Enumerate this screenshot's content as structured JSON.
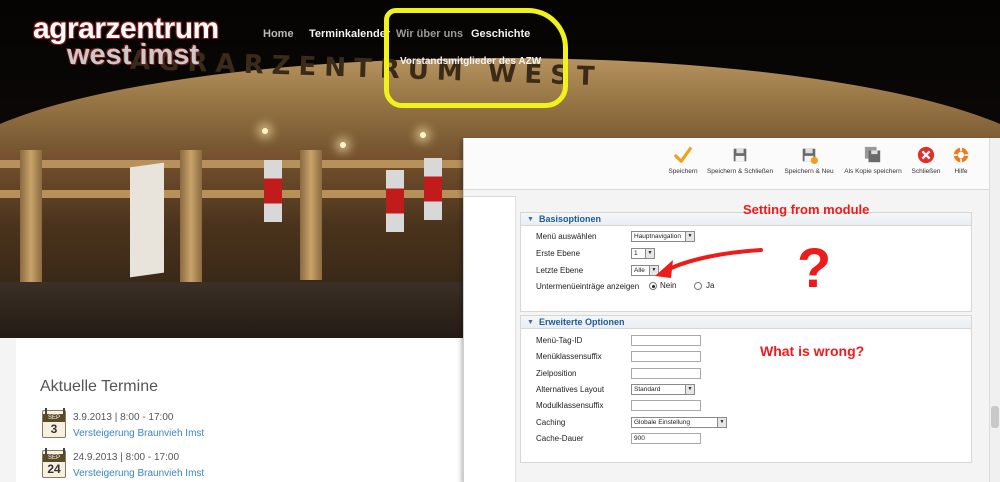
{
  "site": {
    "logo_line1": "agrarzentrum",
    "logo_line2a": "west",
    "logo_line2b": "imst",
    "roof_lettering": "AGRARZENTRUM WEST",
    "nav": {
      "home": "Home",
      "terminkalender": "Terminkalender",
      "wir_ueber_uns": "Wir über uns",
      "geschichte": "Geschichte"
    },
    "subnav_item": "Vorstandsmitglieder des AZW",
    "termine": {
      "title": "Aktuelle Termine",
      "events": [
        {
          "month": "SEP",
          "day": "3",
          "when": "3.9.2013 | 8:00 - 17:00",
          "what": "Versteigerung Braunvieh Imst"
        },
        {
          "month": "SEP",
          "day": "24",
          "when": "24.9.2013 | 8:00 - 17:00",
          "what": "Versteigerung Braunvieh Imst"
        }
      ]
    }
  },
  "admin": {
    "toolbar": {
      "speichern": "Speichern",
      "speichern_schliessen": "Speichern & Schließen",
      "speichern_neu": "Speichern & Neu",
      "als_kopie": "Als Kopie speichern",
      "schliessen": "Schließen",
      "hilfe": "Hilfe"
    },
    "basis": {
      "title": "Basisoptionen",
      "menu_label": "Menü auswählen",
      "menu_value": "Hauptnavigation",
      "erste_label": "Erste Ebene",
      "erste_value": "1",
      "letzte_label": "Letzte Ebene",
      "letzte_value": "Alle",
      "unter_label": "Untermenüeinträge anzeigen",
      "nein": "Nein",
      "ja": "Ja"
    },
    "erweitert": {
      "title": "Erweiterte Optionen",
      "tag_label": "Menü-Tag-ID",
      "klassen_label": "Menüklassensuffix",
      "ziel_label": "Zielposition",
      "layout_label": "Alternatives Layout",
      "layout_value": "Standard",
      "modul_label": "Modulklassensuffix",
      "caching_label": "Caching",
      "caching_value": "Globale Einstellung",
      "cache_dauer_label": "Cache-Dauer",
      "cache_dauer_value": "900"
    }
  },
  "annotations": {
    "setting_note": "Setting from module",
    "question": "?",
    "wrong_note": "What is wrong?",
    "color_red": "#ee1b1b",
    "color_yellow": "#f0f21a"
  }
}
